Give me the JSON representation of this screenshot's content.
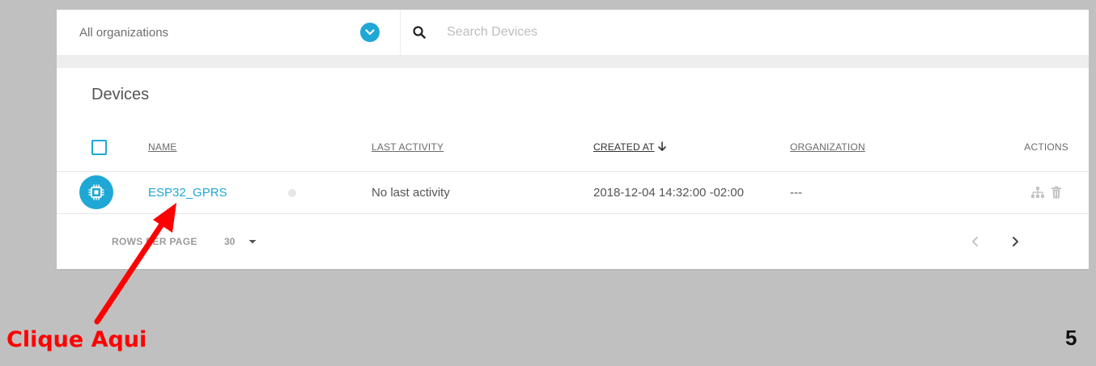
{
  "topbar": {
    "org_select_label": "All organizations",
    "search_placeholder": "Search Devices"
  },
  "devices": {
    "title": "Devices",
    "columns": {
      "name": "NAME",
      "last_activity": "LAST ACTIVITY",
      "created_at": "CREATED AT",
      "organization": "ORGANIZATION",
      "actions": "ACTIONS"
    },
    "rows": [
      {
        "name": "ESP32_GPRS",
        "last_activity": "No last activity",
        "created_at": "2018-12-04 14:32:00 -02:00",
        "organization": "---"
      }
    ],
    "pagination": {
      "rows_per_page_label": "ROWS PER PAGE",
      "rows_per_page_value": "30"
    }
  },
  "annotation": {
    "text": "Clique Aqui",
    "slide_number": "5"
  },
  "colors": {
    "accent": "#1fa8d6",
    "annotation": "#ff0000",
    "background": "#c0c0c0"
  },
  "icons": {
    "org_dropdown": "chevron-down-icon",
    "search": "search-icon",
    "device": "chip-icon",
    "sort": "arrow-down-icon",
    "hierarchy": "hierarchy-icon",
    "delete": "trash-icon",
    "prev": "chevron-left-icon",
    "next": "chevron-right-icon"
  }
}
